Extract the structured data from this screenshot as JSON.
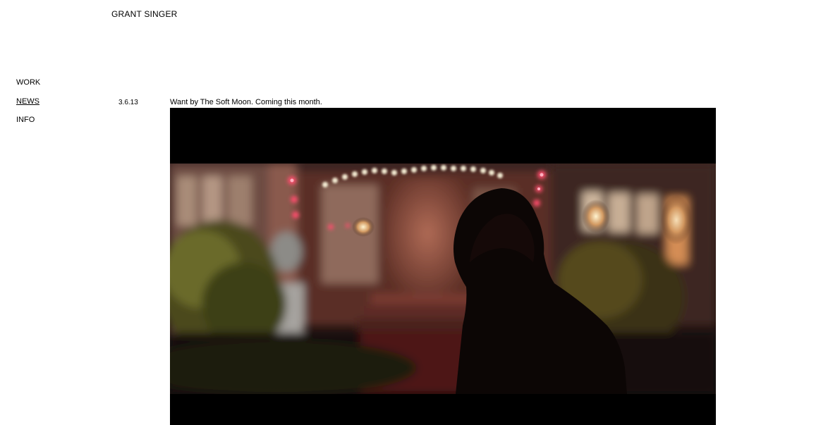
{
  "site": {
    "title": "GRANT SINGER"
  },
  "nav": {
    "items": [
      {
        "label": "WORK",
        "active": false
      },
      {
        "label": "NEWS",
        "active": true
      },
      {
        "label": "INFO",
        "active": false
      }
    ]
  },
  "post": {
    "date": "3.6.13",
    "caption": "Want by The Soft Moon. Coming this month."
  },
  "colors": {
    "background": "#ffffff",
    "text": "#000000",
    "video_letterbox": "#000000",
    "light_pink": "#ff4d6d",
    "light_warm": "#ffe7b3"
  }
}
